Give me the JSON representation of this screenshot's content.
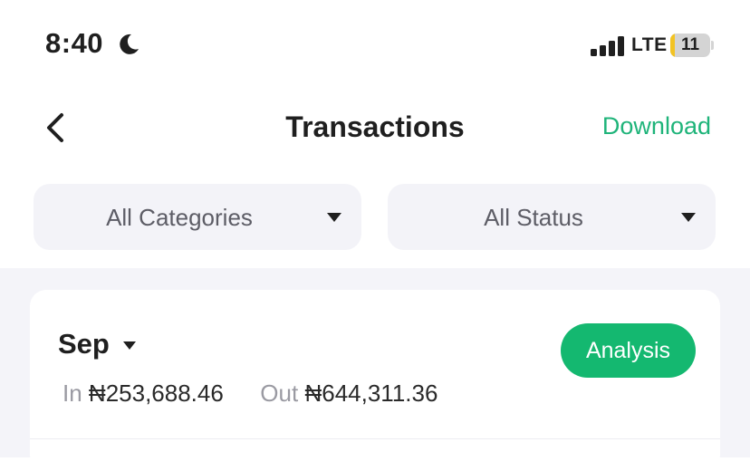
{
  "status_bar": {
    "time": "8:40",
    "network": "LTE",
    "battery": "11",
    "battery_level": 0.11,
    "icons": [
      "moon-icon",
      "signal-icon",
      "battery-icon"
    ]
  },
  "header": {
    "title": "Transactions",
    "download_label": "Download",
    "back_icon": "chevron-left-icon"
  },
  "filters": {
    "category": "All Categories",
    "status": "All Status"
  },
  "summary": {
    "month": "Sep",
    "in_label": "In",
    "in_amount": "₦253,688.46",
    "out_label": "Out",
    "out_amount": "₦644,311.36",
    "analysis_label": "Analysis"
  },
  "colors": {
    "accent": "#14b870",
    "link": "#1fb47a",
    "battery_low": "#f2c324",
    "filter_bg": "#f3f3f8",
    "page_bg": "#f4f4f9"
  }
}
